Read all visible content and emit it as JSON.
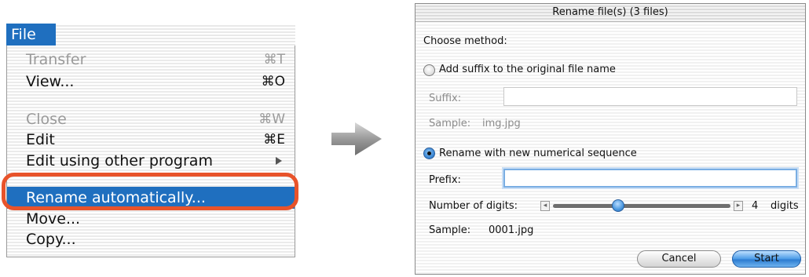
{
  "menu": {
    "title": "File",
    "items": [
      {
        "label": "Transfer",
        "shortcut": "⌘T",
        "disabled": true
      },
      {
        "label": "View...",
        "shortcut": "⌘O",
        "disabled": false
      },
      {
        "label": "Close",
        "shortcut": "⌘W",
        "disabled": true
      },
      {
        "label": "Edit",
        "shortcut": "⌘E",
        "disabled": false
      },
      {
        "label": "Edit using other program",
        "submenu": true
      },
      {
        "label": "Rename automatically...",
        "selected": true
      },
      {
        "label": "Move..."
      },
      {
        "label": "Copy..."
      }
    ]
  },
  "dialog": {
    "title": "Rename file(s) (3 files)",
    "choose_method": "Choose method:",
    "option_suffix": "Add suffix to the original file name",
    "suffix_label": "Suffix:",
    "suffix_value": "",
    "sample_label": "Sample:",
    "suffix_sample": "img.jpg",
    "option_sequence": "Rename with new numerical sequence",
    "prefix_label": "Prefix:",
    "prefix_value": "",
    "digits_label": "Number of digits:",
    "digits_value": "4",
    "digits_unit": "digits",
    "sequence_sample": "0001.jpg",
    "cancel_label": "Cancel",
    "start_label": "Start"
  },
  "colors": {
    "selection": "#1f6fbf",
    "highlight_ring": "#e8532a",
    "accent_button": "#4a9ae6"
  }
}
